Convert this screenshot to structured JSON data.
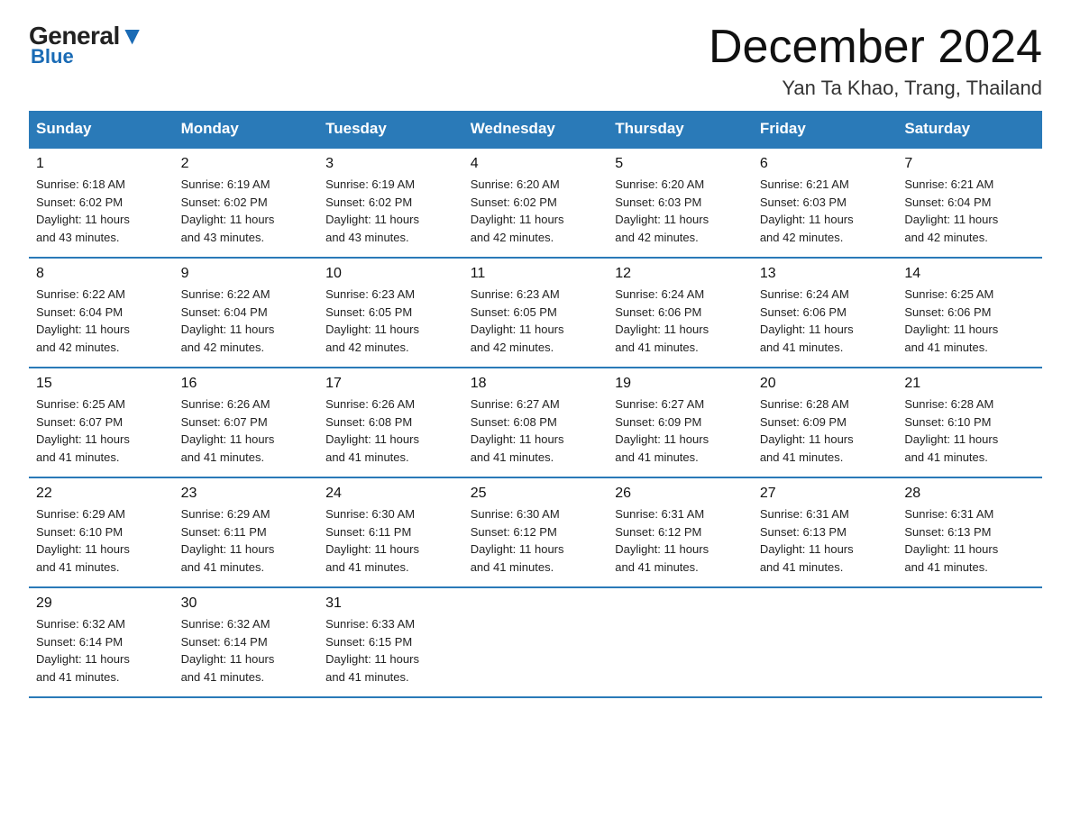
{
  "header": {
    "logo_general": "General",
    "logo_blue": "Blue",
    "title": "December 2024",
    "subtitle": "Yan Ta Khao, Trang, Thailand"
  },
  "days_of_week": [
    "Sunday",
    "Monday",
    "Tuesday",
    "Wednesday",
    "Thursday",
    "Friday",
    "Saturday"
  ],
  "weeks": [
    [
      {
        "day": "1",
        "sunrise": "6:18 AM",
        "sunset": "6:02 PM",
        "daylight": "11 hours and 43 minutes."
      },
      {
        "day": "2",
        "sunrise": "6:19 AM",
        "sunset": "6:02 PM",
        "daylight": "11 hours and 43 minutes."
      },
      {
        "day": "3",
        "sunrise": "6:19 AM",
        "sunset": "6:02 PM",
        "daylight": "11 hours and 43 minutes."
      },
      {
        "day": "4",
        "sunrise": "6:20 AM",
        "sunset": "6:02 PM",
        "daylight": "11 hours and 42 minutes."
      },
      {
        "day": "5",
        "sunrise": "6:20 AM",
        "sunset": "6:03 PM",
        "daylight": "11 hours and 42 minutes."
      },
      {
        "day": "6",
        "sunrise": "6:21 AM",
        "sunset": "6:03 PM",
        "daylight": "11 hours and 42 minutes."
      },
      {
        "day": "7",
        "sunrise": "6:21 AM",
        "sunset": "6:04 PM",
        "daylight": "11 hours and 42 minutes."
      }
    ],
    [
      {
        "day": "8",
        "sunrise": "6:22 AM",
        "sunset": "6:04 PM",
        "daylight": "11 hours and 42 minutes."
      },
      {
        "day": "9",
        "sunrise": "6:22 AM",
        "sunset": "6:04 PM",
        "daylight": "11 hours and 42 minutes."
      },
      {
        "day": "10",
        "sunrise": "6:23 AM",
        "sunset": "6:05 PM",
        "daylight": "11 hours and 42 minutes."
      },
      {
        "day": "11",
        "sunrise": "6:23 AM",
        "sunset": "6:05 PM",
        "daylight": "11 hours and 42 minutes."
      },
      {
        "day": "12",
        "sunrise": "6:24 AM",
        "sunset": "6:06 PM",
        "daylight": "11 hours and 41 minutes."
      },
      {
        "day": "13",
        "sunrise": "6:24 AM",
        "sunset": "6:06 PM",
        "daylight": "11 hours and 41 minutes."
      },
      {
        "day": "14",
        "sunrise": "6:25 AM",
        "sunset": "6:06 PM",
        "daylight": "11 hours and 41 minutes."
      }
    ],
    [
      {
        "day": "15",
        "sunrise": "6:25 AM",
        "sunset": "6:07 PM",
        "daylight": "11 hours and 41 minutes."
      },
      {
        "day": "16",
        "sunrise": "6:26 AM",
        "sunset": "6:07 PM",
        "daylight": "11 hours and 41 minutes."
      },
      {
        "day": "17",
        "sunrise": "6:26 AM",
        "sunset": "6:08 PM",
        "daylight": "11 hours and 41 minutes."
      },
      {
        "day": "18",
        "sunrise": "6:27 AM",
        "sunset": "6:08 PM",
        "daylight": "11 hours and 41 minutes."
      },
      {
        "day": "19",
        "sunrise": "6:27 AM",
        "sunset": "6:09 PM",
        "daylight": "11 hours and 41 minutes."
      },
      {
        "day": "20",
        "sunrise": "6:28 AM",
        "sunset": "6:09 PM",
        "daylight": "11 hours and 41 minutes."
      },
      {
        "day": "21",
        "sunrise": "6:28 AM",
        "sunset": "6:10 PM",
        "daylight": "11 hours and 41 minutes."
      }
    ],
    [
      {
        "day": "22",
        "sunrise": "6:29 AM",
        "sunset": "6:10 PM",
        "daylight": "11 hours and 41 minutes."
      },
      {
        "day": "23",
        "sunrise": "6:29 AM",
        "sunset": "6:11 PM",
        "daylight": "11 hours and 41 minutes."
      },
      {
        "day": "24",
        "sunrise": "6:30 AM",
        "sunset": "6:11 PM",
        "daylight": "11 hours and 41 minutes."
      },
      {
        "day": "25",
        "sunrise": "6:30 AM",
        "sunset": "6:12 PM",
        "daylight": "11 hours and 41 minutes."
      },
      {
        "day": "26",
        "sunrise": "6:31 AM",
        "sunset": "6:12 PM",
        "daylight": "11 hours and 41 minutes."
      },
      {
        "day": "27",
        "sunrise": "6:31 AM",
        "sunset": "6:13 PM",
        "daylight": "11 hours and 41 minutes."
      },
      {
        "day": "28",
        "sunrise": "6:31 AM",
        "sunset": "6:13 PM",
        "daylight": "11 hours and 41 minutes."
      }
    ],
    [
      {
        "day": "29",
        "sunrise": "6:32 AM",
        "sunset": "6:14 PM",
        "daylight": "11 hours and 41 minutes."
      },
      {
        "day": "30",
        "sunrise": "6:32 AM",
        "sunset": "6:14 PM",
        "daylight": "11 hours and 41 minutes."
      },
      {
        "day": "31",
        "sunrise": "6:33 AM",
        "sunset": "6:15 PM",
        "daylight": "11 hours and 41 minutes."
      },
      null,
      null,
      null,
      null
    ]
  ],
  "labels": {
    "sunrise": "Sunrise:",
    "sunset": "Sunset:",
    "daylight": "Daylight:"
  }
}
